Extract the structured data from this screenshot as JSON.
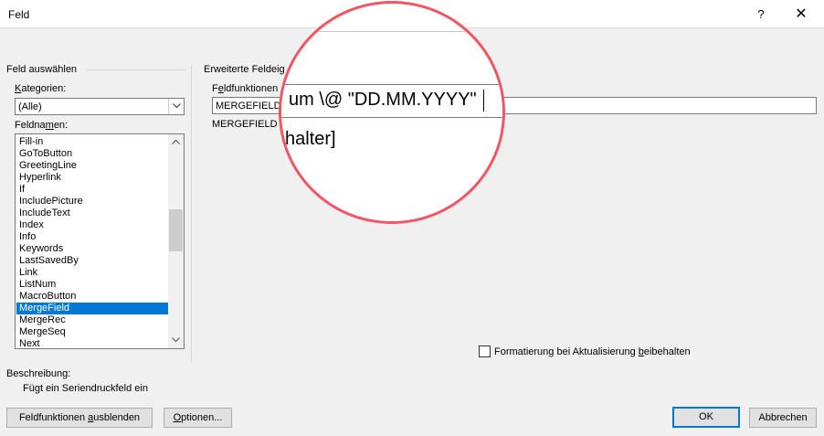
{
  "window": {
    "title": "Feld",
    "help": "?",
    "close": "✕"
  },
  "left_group": {
    "title": "Feld auswählen",
    "categories_label_u": "K",
    "categories_label_rest": "ategorien:",
    "category_value": "(Alle)",
    "fieldnames_label_pre": "Feldna",
    "fieldnames_label_u": "m",
    "fieldnames_label_post": "en:",
    "items": [
      "Fill-in",
      "GoToButton",
      "GreetingLine",
      "Hyperlink",
      "If",
      "IncludePicture",
      "IncludeText",
      "Index",
      "Info",
      "Keywords",
      "LastSavedBy",
      "Link",
      "ListNum",
      "MacroButton",
      "MergeField",
      "MergeRec",
      "MergeSeq",
      "Next"
    ],
    "selected_index": 14
  },
  "right_group": {
    "title": "Erweiterte Feldeig",
    "codes_label_pre": "F",
    "codes_label_u": "e",
    "codes_label_post": "ldfunktionen",
    "code_value": "MERGEFIELD",
    "syntax_text": "MERGEFIELD Fe",
    "preserve_pre": "Formatierung bei Aktualisierung ",
    "preserve_u": "b",
    "preserve_post": "eibehalten"
  },
  "description": {
    "label": "Beschreibung:",
    "text": "Fügt ein Seriendruckfeld ein"
  },
  "buttons": {
    "hide_codes_pre": "Feldfunktionen ",
    "hide_codes_u": "a",
    "hide_codes_post": "usblenden",
    "options_u": "O",
    "options_post": "ptionen...",
    "ok": "OK",
    "cancel": "Abbrechen"
  },
  "magnifier": {
    "line1": "um \\@ \"DD.MM.YYYY\"",
    "line2": "halter]"
  },
  "colors": {
    "selection": "#0078d7",
    "magnifier_ring": "#f25563"
  },
  "icons": {
    "combo_arrow": "chevron-down-icon",
    "scroll_up": "scroll-up-icon",
    "scroll_down": "scroll-down-icon"
  }
}
